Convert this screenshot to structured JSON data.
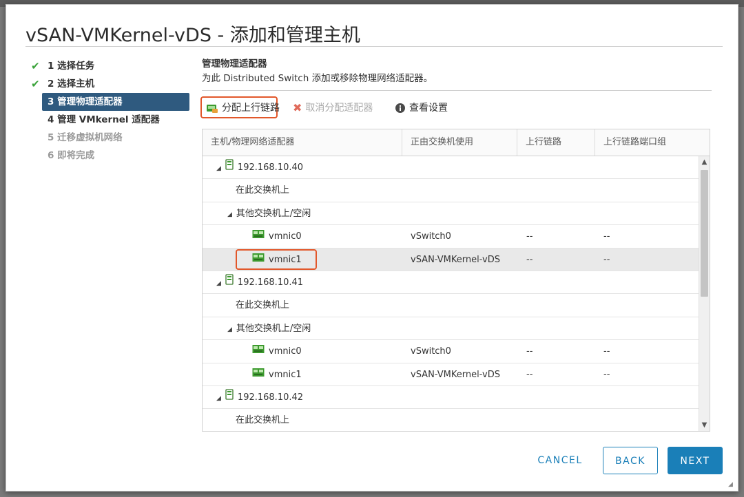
{
  "dialog": {
    "title": "vSAN-VMKernel-vDS - 添加和管理主机"
  },
  "steps": [
    {
      "label": "1 选择任务",
      "state": "done"
    },
    {
      "label": "2 选择主机",
      "state": "done"
    },
    {
      "label": "3 管理物理适配器",
      "state": "current"
    },
    {
      "label": "4 管理 VMkernel 适配器",
      "state": "pending"
    },
    {
      "label": "5 迁移虚拟机网络",
      "state": "disabled"
    },
    {
      "label": "6 即将完成",
      "state": "disabled"
    }
  ],
  "section": {
    "title": "管理物理适配器",
    "description": "为此 Distributed Switch 添加或移除物理网络适配器。"
  },
  "toolbar": {
    "assign_uplink": "分配上行链路",
    "unassign_adapter": "取消分配适配器",
    "view_settings": "查看设置"
  },
  "grid": {
    "columns": [
      "主机/物理网络适配器",
      "正由交换机使用",
      "上行链路",
      "上行链路端口组"
    ],
    "rows": [
      {
        "type": "host",
        "name": "192.168.10.40",
        "switch": "",
        "uplink": "",
        "portgroup": ""
      },
      {
        "type": "group",
        "name": "在此交换机上",
        "switch": "",
        "uplink": "",
        "portgroup": ""
      },
      {
        "type": "group-expanded",
        "name": "其他交换机上/空闲",
        "switch": "",
        "uplink": "",
        "portgroup": ""
      },
      {
        "type": "nic",
        "name": "vmnic0",
        "switch": "vSwitch0",
        "uplink": "--",
        "portgroup": "--"
      },
      {
        "type": "nic",
        "name": "vmnic1",
        "switch": "vSAN-VMKernel-vDS",
        "uplink": "--",
        "portgroup": "--",
        "selected": true
      },
      {
        "type": "host",
        "name": "192.168.10.41",
        "switch": "",
        "uplink": "",
        "portgroup": ""
      },
      {
        "type": "group",
        "name": "在此交换机上",
        "switch": "",
        "uplink": "",
        "portgroup": ""
      },
      {
        "type": "group-expanded",
        "name": "其他交换机上/空闲",
        "switch": "",
        "uplink": "",
        "portgroup": ""
      },
      {
        "type": "nic",
        "name": "vmnic0",
        "switch": "vSwitch0",
        "uplink": "--",
        "portgroup": "--"
      },
      {
        "type": "nic",
        "name": "vmnic1",
        "switch": "vSAN-VMKernel-vDS",
        "uplink": "--",
        "portgroup": "--"
      },
      {
        "type": "host",
        "name": "192.168.10.42",
        "switch": "",
        "uplink": "",
        "portgroup": ""
      },
      {
        "type": "group",
        "name": "在此交换机上",
        "switch": "",
        "uplink": "",
        "portgroup": ""
      }
    ]
  },
  "footer": {
    "cancel": "CANCEL",
    "back": "BACK",
    "next": "NEXT"
  },
  "icons": {
    "step_done": "checkmark-icon",
    "assign": "network-adapter-plus-icon",
    "unassign": "red-x-icon",
    "info": "info-icon",
    "host": "server-host-icon",
    "nic": "network-card-icon"
  },
  "colors": {
    "accent": "#1a7fb8",
    "current_step_bg": "#2f5a7f",
    "highlight": "#e2572a",
    "check": "#3aa33a",
    "nic_green": "#3c9a2e"
  }
}
